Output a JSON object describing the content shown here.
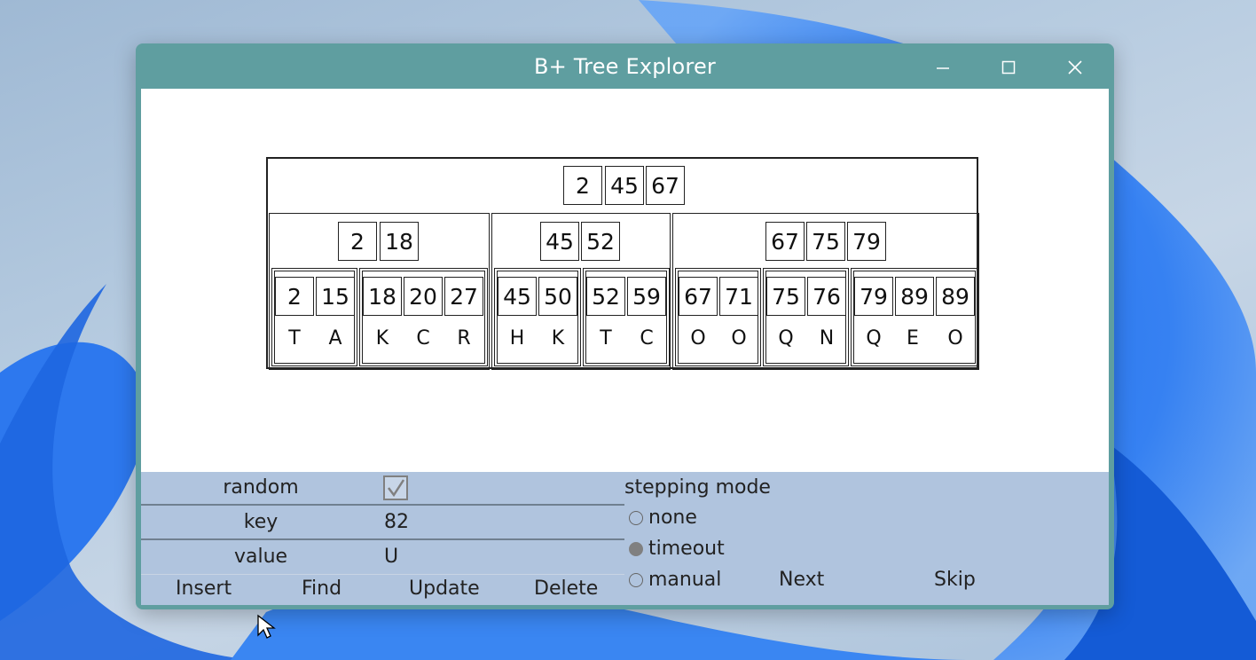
{
  "window": {
    "title": "B+ Tree Explorer",
    "minimize_icon": "minimize-icon",
    "maximize_icon": "maximize-icon",
    "close_icon": "close-icon"
  },
  "tree": {
    "root": {
      "keys": [
        "2",
        "45",
        "67"
      ]
    },
    "internal": [
      {
        "keys": [
          "2",
          "18"
        ],
        "leaves": [
          {
            "keys": [
              "2",
              "15"
            ],
            "values": [
              "T",
              "A"
            ]
          },
          {
            "keys": [
              "18",
              "20",
              "27"
            ],
            "values": [
              "K",
              "C",
              "R"
            ]
          }
        ]
      },
      {
        "keys": [
          "45",
          "52"
        ],
        "leaves": [
          {
            "keys": [
              "45",
              "50"
            ],
            "values": [
              "H",
              "K"
            ]
          },
          {
            "keys": [
              "52",
              "59"
            ],
            "values": [
              "T",
              "C"
            ]
          }
        ]
      },
      {
        "keys": [
          "67",
          "75",
          "79"
        ],
        "leaves": [
          {
            "keys": [
              "67",
              "71"
            ],
            "values": [
              "O",
              "O"
            ]
          },
          {
            "keys": [
              "75",
              "76"
            ],
            "values": [
              "Q",
              "N"
            ]
          },
          {
            "keys": [
              "79",
              "89",
              "89"
            ],
            "values": [
              "Q",
              "E",
              "O"
            ]
          }
        ]
      }
    ]
  },
  "controls": {
    "random_label": "random",
    "random_checked": true,
    "key_label": "key",
    "key_value": "82",
    "value_label": "value",
    "value_value": "U",
    "buttons": {
      "insert": "Insert",
      "find": "Find",
      "update": "Update",
      "delete": "Delete"
    },
    "stepping_mode_label": "stepping mode",
    "stepping_options": {
      "none": "none",
      "timeout": "timeout",
      "manual": "manual"
    },
    "stepping_selected": "timeout",
    "next_label": "Next",
    "skip_label": "Skip"
  },
  "colors": {
    "titlebar": "#5f9ea0",
    "panel": "#b0c4de",
    "row_divider": "#708090"
  }
}
